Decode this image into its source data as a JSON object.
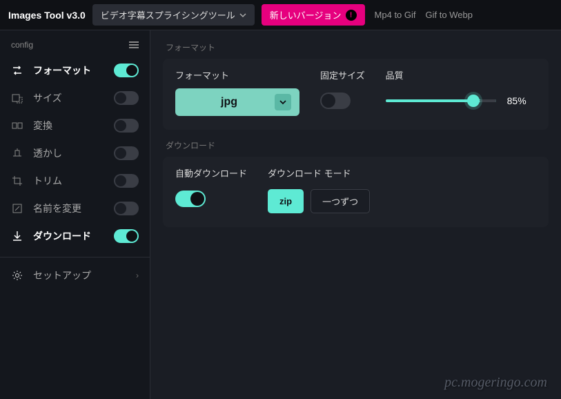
{
  "header": {
    "app_title": "Images Tool v3.0",
    "tool_dropdown": "ビデオ字幕スプライシングツール",
    "new_version": "新しいバージョン",
    "link_mp4": "Mp4 to Gif",
    "link_gif": "Gif to Webp"
  },
  "sidebar": {
    "config_label": "config",
    "items": [
      {
        "label": "フォーマット",
        "on": true
      },
      {
        "label": "サイズ",
        "on": false
      },
      {
        "label": "変換",
        "on": false
      },
      {
        "label": "透かし",
        "on": false
      },
      {
        "label": "トリム",
        "on": false
      },
      {
        "label": "名前を変更",
        "on": false
      },
      {
        "label": "ダウンロード",
        "on": true
      }
    ],
    "setup_label": "セットアップ"
  },
  "main": {
    "format_section": "フォーマット",
    "format_label": "フォーマット",
    "format_value": "jpg",
    "fixed_size_label": "固定サイズ",
    "fixed_size_on": false,
    "quality_label": "品質",
    "quality_value": "85%",
    "download_section": "ダウンロード",
    "auto_dl_label": "自動ダウンロード",
    "auto_dl_on": true,
    "dl_mode_label": "ダウンロード モード",
    "dl_mode_zip": "zip",
    "dl_mode_one": "一つずつ"
  },
  "watermark": "pc.mogeringo.com"
}
